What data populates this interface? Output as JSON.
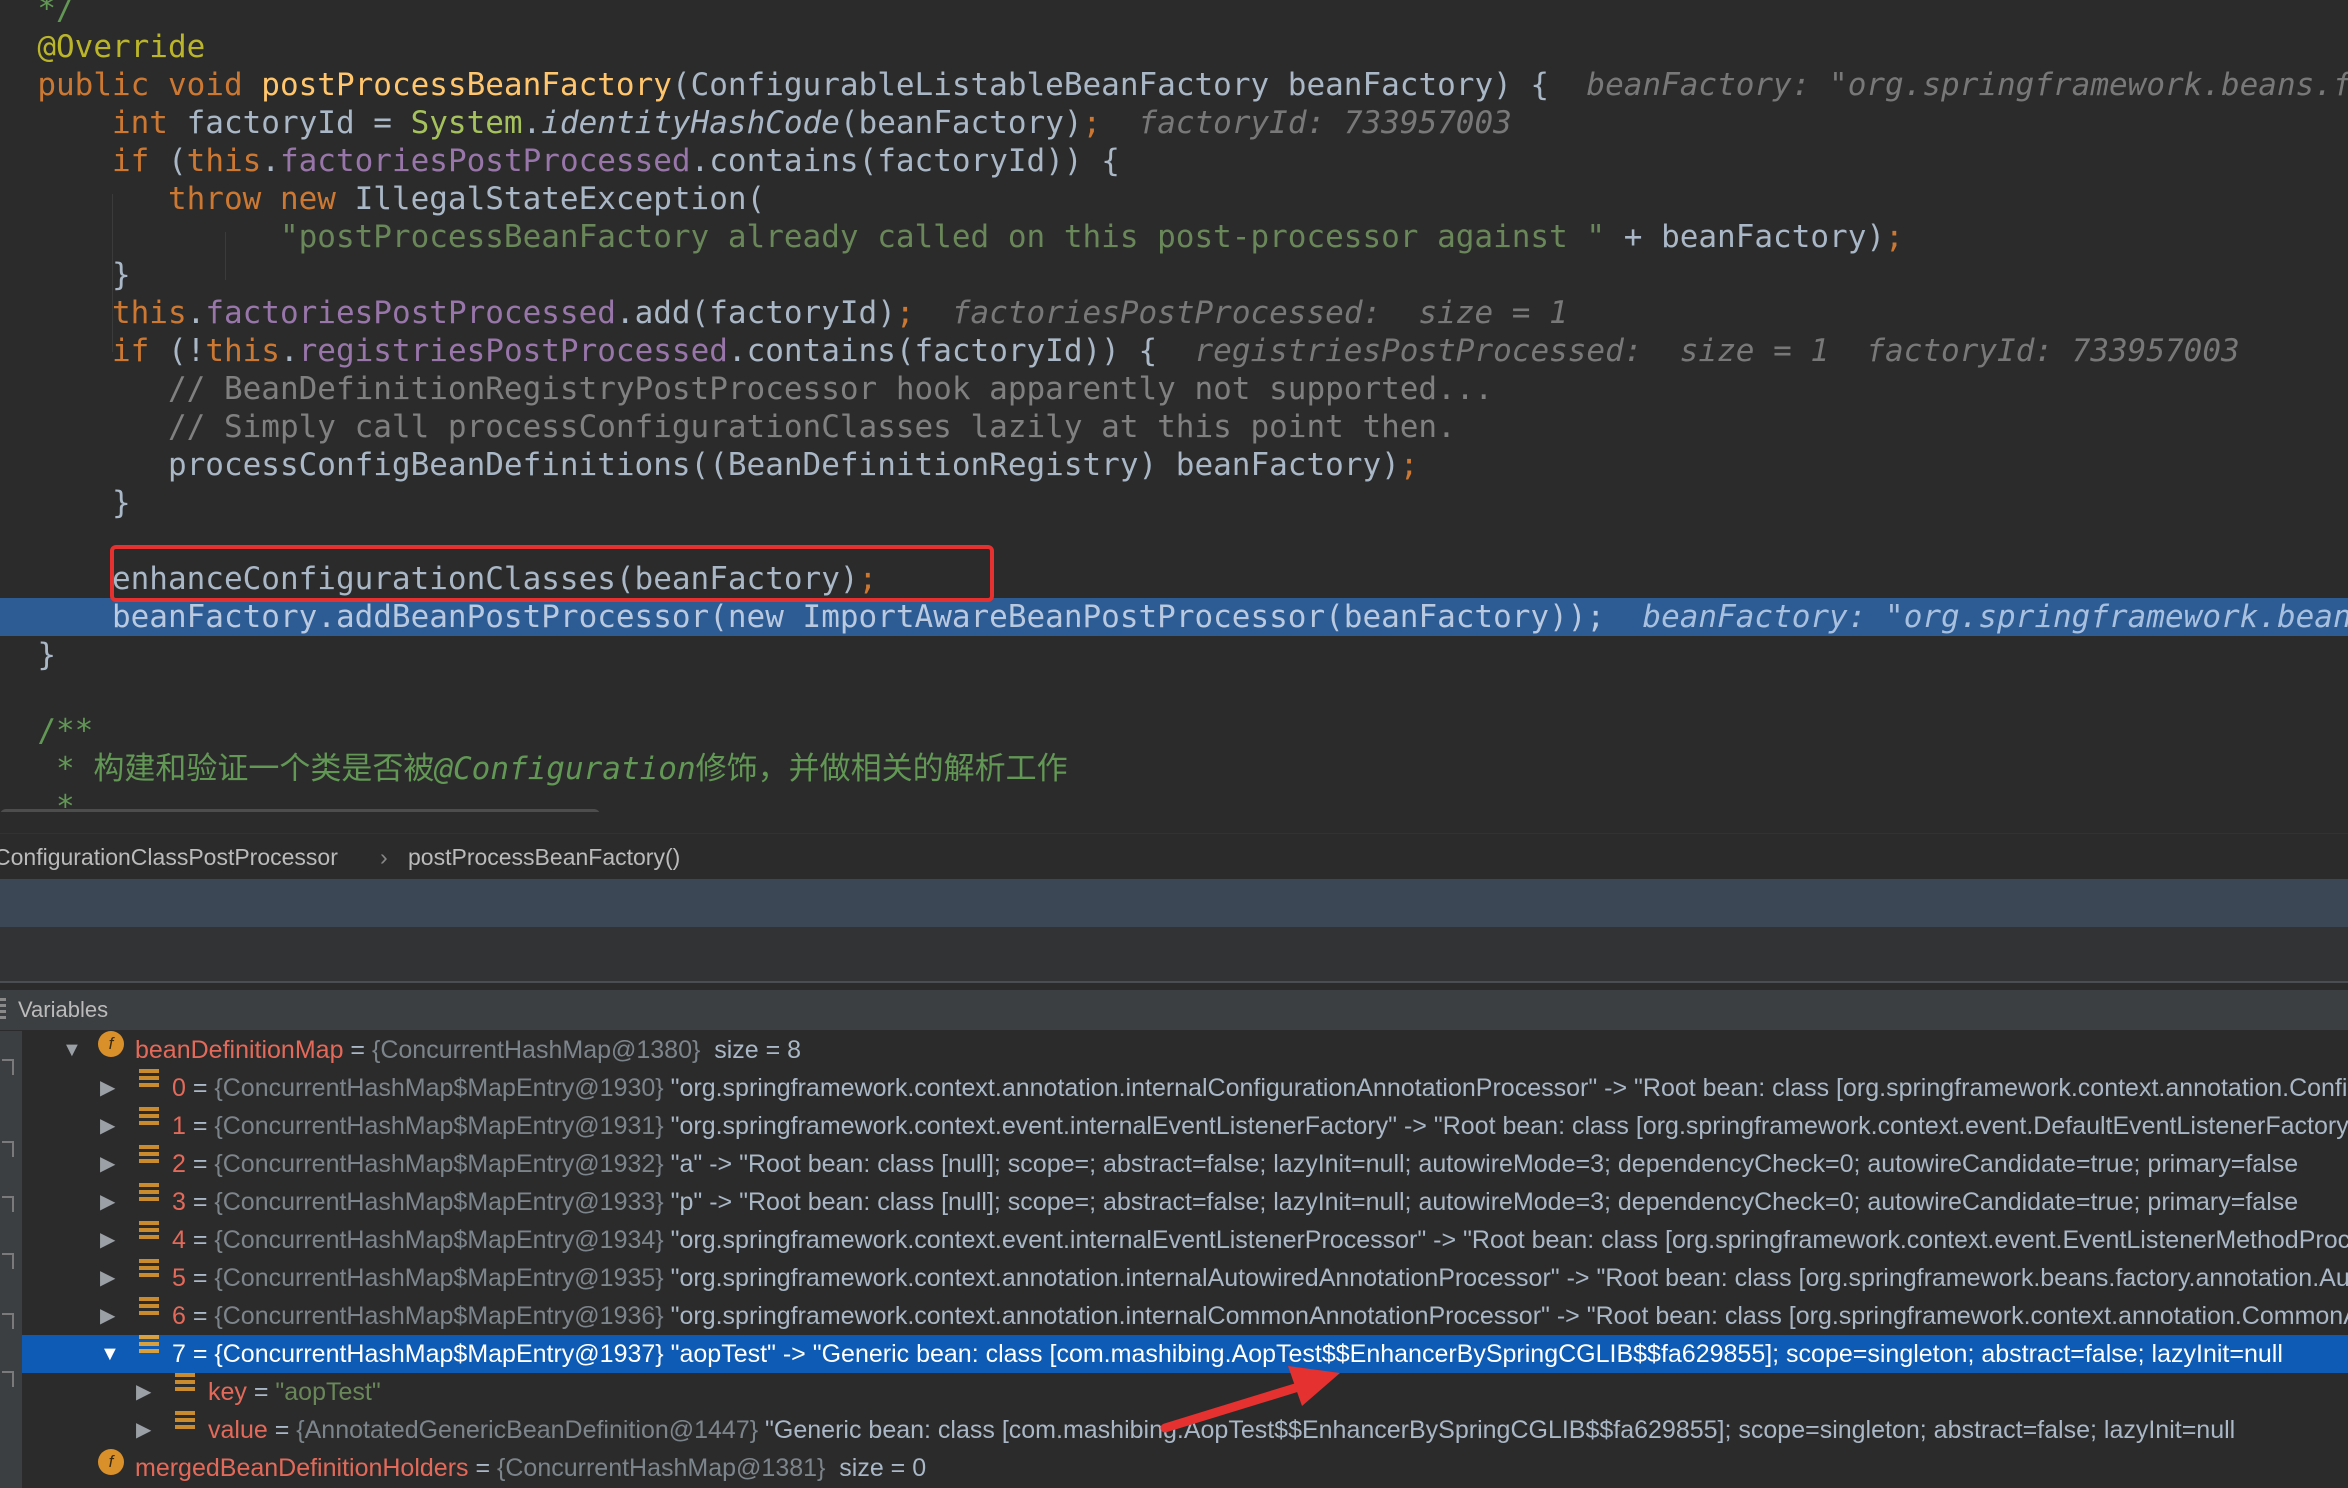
{
  "editor": {
    "lines": [
      [
        {
          "c": "doc",
          "t": "  */"
        }
      ],
      [
        {
          "c": "ann",
          "t": "  @Override"
        }
      ],
      [
        {
          "c": "kw",
          "t": "  public void "
        },
        {
          "c": "fn",
          "t": "postProcessBeanFactory"
        },
        {
          "c": "txt",
          "t": "(ConfigurableListableBeanFactory beanFactory) {  "
        },
        {
          "c": "hint",
          "t": "beanFactory: \"org.springframework.beans.factory.support.DefaultListableBeanFactory"
        }
      ],
      [
        {
          "c": "kw",
          "t": "      int "
        },
        {
          "c": "txt",
          "t": "factoryId = "
        },
        {
          "c": "sys",
          "t": "System"
        },
        {
          "c": "txt",
          "t": "."
        },
        {
          "c": "it",
          "t": "identityHashCode"
        },
        {
          "c": "txt",
          "t": "(beanFactory)"
        },
        {
          "c": "kw",
          "t": ";  "
        },
        {
          "c": "hint",
          "t": "factoryId: 733957003"
        }
      ],
      [
        {
          "c": "kw",
          "t": "      if "
        },
        {
          "c": "txt",
          "t": "("
        },
        {
          "c": "kw",
          "t": "this"
        },
        {
          "c": "txt",
          "t": "."
        },
        {
          "c": "field",
          "t": "factoriesPostProcessed"
        },
        {
          "c": "txt",
          "t": ".contains(factoryId)) {"
        }
      ],
      [
        {
          "c": "kw",
          "t": "         throw new "
        },
        {
          "c": "txt",
          "t": "IllegalStateException("
        }
      ],
      [
        {
          "c": "str",
          "t": "               \"postProcessBeanFactory already called on this post-processor against \""
        },
        {
          "c": "txt",
          "t": " + beanFactory)"
        },
        {
          "c": "kw",
          "t": ";"
        }
      ],
      [
        {
          "c": "txt",
          "t": "      }"
        }
      ],
      [
        {
          "c": "kw",
          "t": "      this"
        },
        {
          "c": "txt",
          "t": "."
        },
        {
          "c": "field",
          "t": "factoriesPostProcessed"
        },
        {
          "c": "txt",
          "t": ".add(factoryId)"
        },
        {
          "c": "kw",
          "t": ";  "
        },
        {
          "c": "hint",
          "t": "factoriesPostProcessed:  size = 1"
        }
      ],
      [
        {
          "c": "kw",
          "t": "      if "
        },
        {
          "c": "txt",
          "t": "(!"
        },
        {
          "c": "kw",
          "t": "this"
        },
        {
          "c": "txt",
          "t": "."
        },
        {
          "c": "field",
          "t": "registriesPostProcessed"
        },
        {
          "c": "txt",
          "t": ".contains(factoryId)) {  "
        },
        {
          "c": "hint",
          "t": "registriesPostProcessed:  size = 1  factoryId: 733957003"
        }
      ],
      [
        {
          "c": "cmt",
          "t": "         // BeanDefinitionRegistryPostProcessor hook apparently not supported..."
        }
      ],
      [
        {
          "c": "cmt",
          "t": "         // Simply call processConfigurationClasses lazily at this point then."
        }
      ],
      [
        {
          "c": "txt",
          "t": "         processConfigBeanDefinitions((BeanDefinitionRegistry) beanFactory)"
        },
        {
          "c": "kw",
          "t": ";"
        }
      ],
      [
        {
          "c": "txt",
          "t": "      }"
        }
      ],
      [
        {
          "c": "txt",
          "t": ""
        }
      ],
      [
        {
          "c": "txt",
          "t": "      enhanceConfigurationClasses(beanFactory)"
        },
        {
          "c": "kw",
          "t": ";"
        }
      ],
      [
        {
          "c": "txt",
          "t": "      beanFactory.addBeanPostProcessor("
        },
        {
          "c": "kw",
          "t": "new "
        },
        {
          "c": "txt",
          "t": "ImportAwareBeanPostProcessor(beanFactory))"
        },
        {
          "c": "kw",
          "t": ";  "
        },
        {
          "c": "hint",
          "t": "beanFactory: \"org.springframework.beans.factory.support.DefaultListableBeanFactory"
        }
      ],
      [
        {
          "c": "txt",
          "t": "  }"
        }
      ],
      [
        {
          "c": "txt",
          "t": ""
        }
      ],
      [
        {
          "c": "doc",
          "t": "  /**"
        }
      ],
      [
        {
          "c": "doc",
          "t": "   * 构建和验证一个类是否被"
        },
        {
          "c": "docb",
          "t": "@Configuration"
        },
        {
          "c": "doc",
          "t": "修饰，并做相关的解析工作"
        }
      ],
      [
        {
          "c": "doc",
          "t": "   *"
        }
      ]
    ],
    "current_line": 16
  },
  "breadcrumb": {
    "class_name": "ConfigurationClassPostProcessor",
    "separator": "›",
    "method_name": "postProcessBeanFactory()"
  },
  "variables_panel": {
    "title": "Variables",
    "rows": [
      {
        "toggle": "▼",
        "icon": "field",
        "name": "beanDefinitionMap",
        "eq": " = ",
        "obj": "{ConcurrentHashMap@1380}",
        "rest": "  size = 8"
      },
      {
        "toggle": "▶",
        "icon": "entry",
        "name": "0",
        "eq": " = ",
        "obj": "{ConcurrentHashMap$MapEntry@1930}",
        "rest": " \"org.springframework.context.annotation.internalConfigurationAnnotationProcessor\" -> \"Root bean: class [org.springframework.context.annotation.ConfigurationClassPostProcessor]"
      },
      {
        "toggle": "▶",
        "icon": "entry",
        "name": "1",
        "eq": " = ",
        "obj": "{ConcurrentHashMap$MapEntry@1931}",
        "rest": " \"org.springframework.context.event.internalEventListenerFactory\" -> \"Root bean: class [org.springframework.context.event.DefaultEventListenerFactory]"
      },
      {
        "toggle": "▶",
        "icon": "entry",
        "name": "2",
        "eq": " = ",
        "obj": "{ConcurrentHashMap$MapEntry@1932}",
        "rest": " \"a\" -> \"Root bean: class [null]; scope=; abstract=false; lazyInit=null; autowireMode=3; dependencyCheck=0; autowireCandidate=true; primary=false"
      },
      {
        "toggle": "▶",
        "icon": "entry",
        "name": "3",
        "eq": " = ",
        "obj": "{ConcurrentHashMap$MapEntry@1933}",
        "rest": " \"p\" -> \"Root bean: class [null]; scope=; abstract=false; lazyInit=null; autowireMode=3; dependencyCheck=0; autowireCandidate=true; primary=false"
      },
      {
        "toggle": "▶",
        "icon": "entry",
        "name": "4",
        "eq": " = ",
        "obj": "{ConcurrentHashMap$MapEntry@1934}",
        "rest": " \"org.springframework.context.event.internalEventListenerProcessor\" -> \"Root bean: class [org.springframework.context.event.EventListenerMethodProcessor]"
      },
      {
        "toggle": "▶",
        "icon": "entry",
        "name": "5",
        "eq": " = ",
        "obj": "{ConcurrentHashMap$MapEntry@1935}",
        "rest": " \"org.springframework.context.annotation.internalAutowiredAnnotationProcessor\" -> \"Root bean: class [org.springframework.beans.factory.annotation.AutowiredAnnotationBeanPostProcessor]"
      },
      {
        "toggle": "▶",
        "icon": "entry",
        "name": "6",
        "eq": " = ",
        "obj": "{ConcurrentHashMap$MapEntry@1936}",
        "rest": " \"org.springframework.context.annotation.internalCommonAnnotationProcessor\" -> \"Root bean: class [org.springframework.context.annotation.CommonAnnotationBeanPostProcessor]"
      },
      {
        "toggle": "▼",
        "icon": "entry",
        "name": "7",
        "eq": " = ",
        "obj": "{ConcurrentHashMap$MapEntry@1937}",
        "rest": " \"aopTest\" -> \"Generic bean: class [com.mashibing.AopTest$$EnhancerBySpringCGLIB$$fa629855]; scope=singleton; abstract=false; lazyInit=null",
        "selected": true
      },
      {
        "toggle": "▶",
        "icon": "entry",
        "name": "key",
        "eq": " = ",
        "obj": "",
        "rest": "\"aopTest\"",
        "indent": 1,
        "string": true
      },
      {
        "toggle": "▶",
        "icon": "entry",
        "name": "value",
        "eq": " = ",
        "obj": "{AnnotatedGenericBeanDefinition@1447}",
        "rest": " \"Generic bean: class [com.mashibing.AopTest$$EnhancerBySpringCGLIB$$fa629855]; scope=singleton; abstract=false; lazyInit=null",
        "indent": 1
      },
      {
        "toggle": "",
        "icon": "field",
        "name": "mergedBeanDefinitionHolders",
        "eq": " = ",
        "obj": "{ConcurrentHashMap@1381}",
        "rest": "  size = 0"
      }
    ]
  },
  "colors": {
    "editor_bg": "#2b2b2b",
    "current_line": "#2d5b93",
    "selection": "#0d5bb5",
    "keyword": "#cc7832",
    "field": "#9876aa",
    "string": "#6a8759",
    "highlight_box": "#e5312f",
    "arrow": "#e5312f"
  }
}
